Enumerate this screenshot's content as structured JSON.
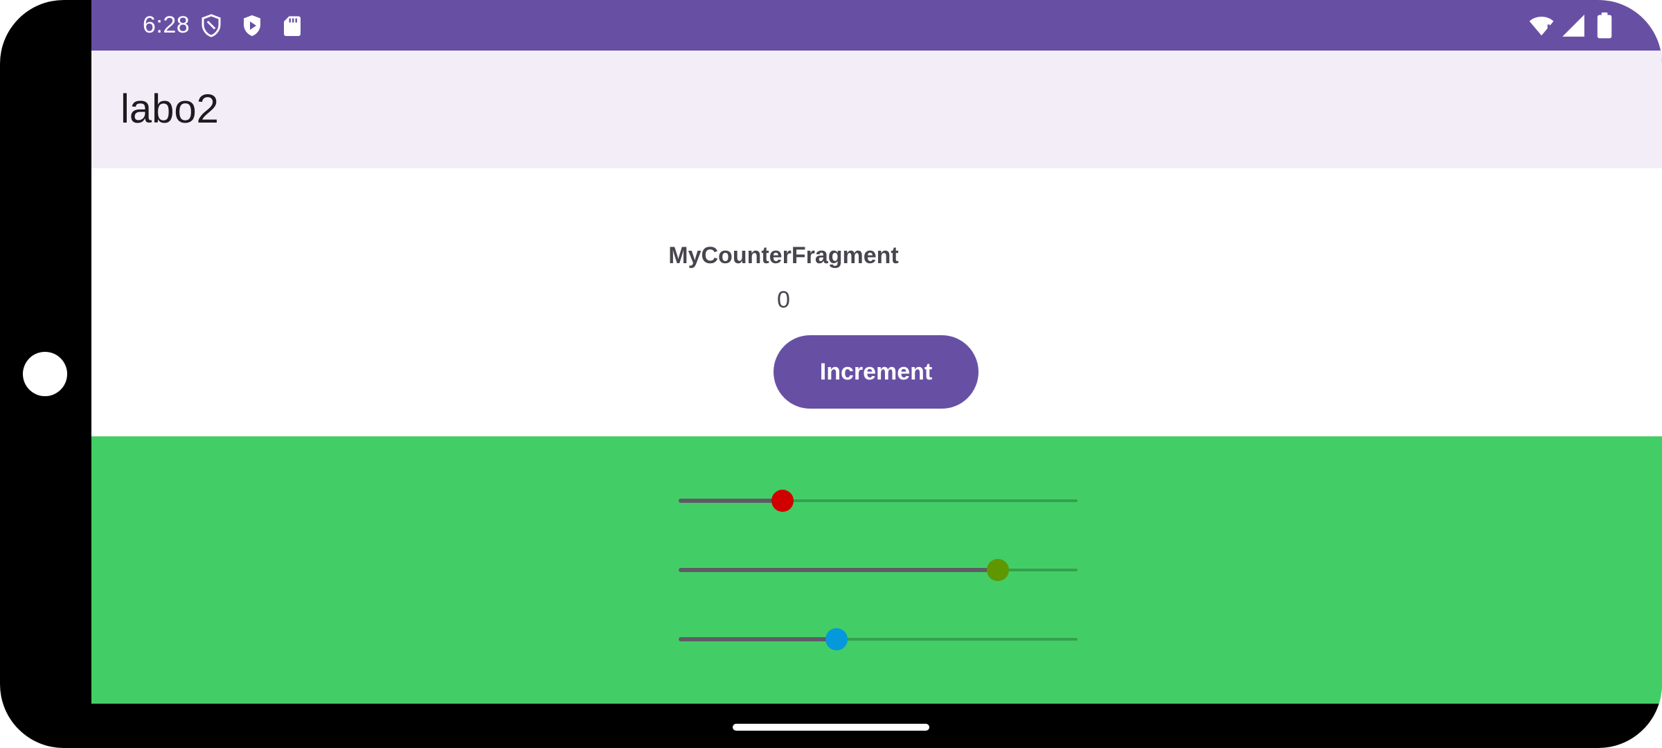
{
  "status_bar": {
    "time": "6:28",
    "left_icons": [
      "shield-outline-icon",
      "play-protect-icon",
      "sd-card-icon"
    ],
    "right_icons": [
      "wifi-icon",
      "cell-signal-icon",
      "battery-icon"
    ],
    "background_color": "#6750a4"
  },
  "app_bar": {
    "title": "labo2",
    "background_color": "#f3edf7"
  },
  "counter": {
    "fragment_title": "MyCounterFragment",
    "value": "0",
    "increment_label": "Increment",
    "button_color": "#6750a4"
  },
  "sliders": {
    "background_color": "#43cd66",
    "items": [
      {
        "name": "red",
        "value": 0.26,
        "thumb_color": "#d00000"
      },
      {
        "name": "green",
        "value": 0.8,
        "thumb_color": "#5f9700"
      },
      {
        "name": "blue",
        "value": 0.395,
        "thumb_color": "#0598da"
      }
    ]
  }
}
